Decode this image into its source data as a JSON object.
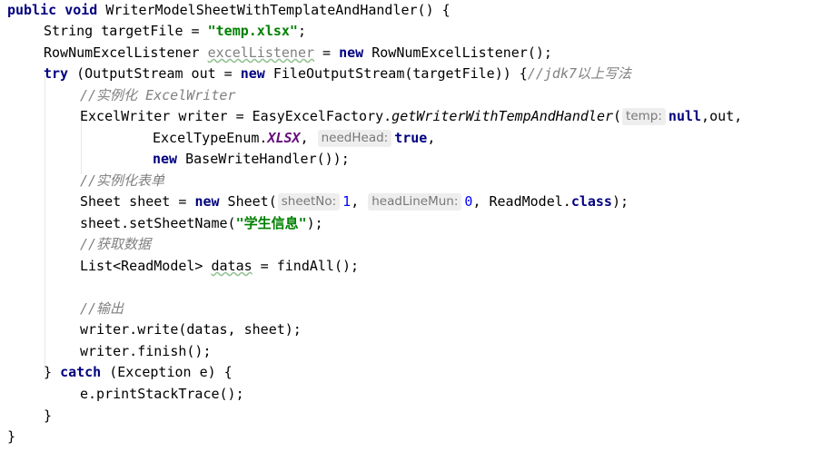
{
  "editor": {
    "language": "java",
    "colors": {
      "keyword": "#000080",
      "string": "#008000",
      "number": "#0000ff",
      "comment": "#808080",
      "static_const": "#660e7a",
      "param_hint_bg": "#eeeeee"
    },
    "lines": {
      "l1": {
        "kw_public": "public",
        "kw_void": "void",
        "text": " WriterModelSheetWithTemplateAndHandler() {"
      },
      "l2": {
        "type": "String targetFile = ",
        "string": "\"temp.xlsx\"",
        "end": ";"
      },
      "l3": {
        "type": "RowNumExcelListener ",
        "var_unused": "excelListener",
        "eq": " = ",
        "kw_new": "new",
        "ctor": " RowNumExcelListener();"
      },
      "l4": {
        "kw_try": "try",
        "text": " (OutputStream out = ",
        "kw_new": "new",
        "ctor": " FileOutputStream(targetFile)) {",
        "comment": "//jdk7以上写法"
      },
      "l5": {
        "comment": "//实例化 ExcelWriter"
      },
      "l6": {
        "pre": "ExcelWriter writer = EasyExcelFactory.",
        "method": "getWriterWithTempAndHandler",
        "paren": "(",
        "hint_temp": "temp:",
        "kw_null": "null",
        "tail": ",out,"
      },
      "l7": {
        "pre": "ExcelTypeEnum.",
        "enum_const": "XLSX",
        "comma": ",",
        "hint_needhead": "needHead:",
        "kw_true": "true",
        "tail": ","
      },
      "l8": {
        "kw_new": "new",
        "text": " BaseWriteHandler());"
      },
      "l9": {
        "comment": "//实例化表单"
      },
      "l10": {
        "pre": "Sheet sheet = ",
        "kw_new": "new",
        "ctor": " Sheet(",
        "hint_sheetno": "sheetNo:",
        "num_sheetno": "1",
        "comma": ", ",
        "hint_headlinemun": "headLineMun:",
        "num_headline": "0",
        "mid": ", ReadModel.",
        "kw_class": "class",
        "tail": ");"
      },
      "l11": {
        "pre": "sheet.setSheetName(",
        "string": "\"学生信息\"",
        "tail": ");"
      },
      "l12": {
        "comment": "//获取数据"
      },
      "l13": {
        "pre": "List<ReadModel> ",
        "var": "datas",
        "tail": " = findAll();"
      },
      "l15": {
        "comment": "//输出"
      },
      "l16": {
        "text": "writer.write(datas, sheet);"
      },
      "l17": {
        "text": "writer.finish();"
      },
      "l18": {
        "pre": "} ",
        "kw_catch": "catch",
        "tail": " (Exception e) {"
      },
      "l19": {
        "text": "e.printStackTrace();"
      },
      "l20": {
        "text": "}"
      },
      "l21": {
        "text": "}"
      }
    }
  }
}
